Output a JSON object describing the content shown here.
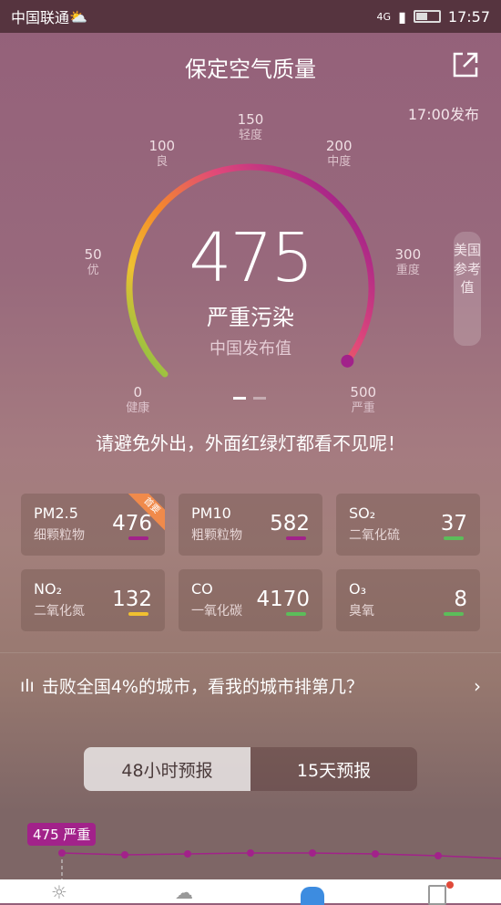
{
  "status": {
    "carrier": "中国联通",
    "network": "4G",
    "time": "17:57",
    "battery_level": 0.45
  },
  "header": {
    "title": "保定空气质量",
    "publish_time": "17:00发布"
  },
  "gauge": {
    "value": "475",
    "level": "严重污染",
    "source": "中国发布值",
    "min": 0,
    "max": 500,
    "fraction": 0.97,
    "ticks": [
      {
        "value": "0",
        "label": "健康"
      },
      {
        "value": "50",
        "label": "优"
      },
      {
        "value": "100",
        "label": "良"
      },
      {
        "value": "150",
        "label": "轻度"
      },
      {
        "value": "200",
        "label": "中度"
      },
      {
        "value": "300",
        "label": "重度"
      },
      {
        "value": "500",
        "label": "严重"
      }
    ],
    "us_reference": "美国参考值",
    "page_index": 0,
    "page_count": 2
  },
  "tip": "请避免外出，外面红绿灯都看不见呢！",
  "pollutants": [
    {
      "name": "PM2.5",
      "cn": "细颗粒物",
      "value": "476",
      "color": "#a2228a",
      "badge": "首要"
    },
    {
      "name": "PM10",
      "cn": "粗颗粒物",
      "value": "582",
      "color": "#a2228a"
    },
    {
      "name": "SO₂",
      "cn": "二氧化硫",
      "value": "37",
      "color": "#5cbd5a"
    },
    {
      "name": "NO₂",
      "cn": "二氧化氮",
      "value": "132",
      "color": "#f0c030"
    },
    {
      "name": "CO",
      "cn": "一氧化碳",
      "value": "4170",
      "color": "#5cbd5a"
    },
    {
      "name": "O₃",
      "cn": "臭氧",
      "value": "8",
      "color": "#5cbd5a"
    }
  ],
  "ranking": {
    "text": "击败全国4%的城市，看我的城市排第几？"
  },
  "forecast": {
    "tabs": [
      "48小时预报",
      "15天预报"
    ],
    "active": 0,
    "current_tag": "475 严重"
  }
}
